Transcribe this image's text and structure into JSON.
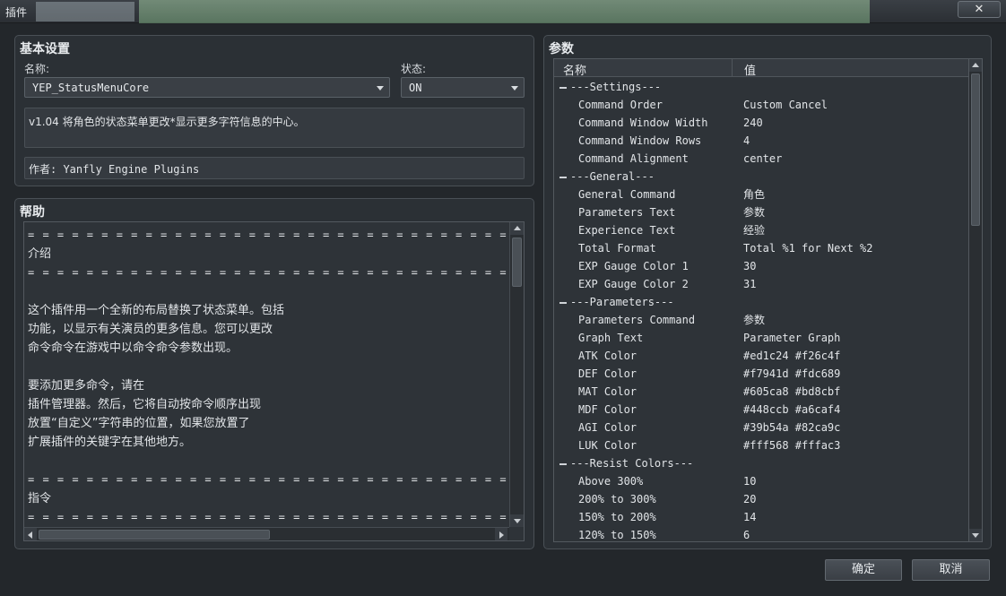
{
  "window": {
    "title": "插件",
    "close_glyph": "✕"
  },
  "basic": {
    "title": "基本设置",
    "name_label": "名称:",
    "name_value": "YEP_StatusMenuCore",
    "status_label": "状态:",
    "status_value": "ON",
    "description": "v1.04 将角色的状态菜单更改*显示更多字符信息的中心。",
    "author": "作者: Yanfly Engine Plugins"
  },
  "help": {
    "title": "帮助",
    "lines": [
      "= = = = = = = = = = = = = = = = = = = = = = = = = = = = = = = = = = = = = = = = = = = = = =",
      "介绍",
      "= = = = = = = = = = = = = = = = = = = = = = = = = = = = = = = = = = = = = = = = = = = = = =",
      "",
      "这个插件用一个全新的布局替换了状态菜单。包括",
      "功能，以显示有关演员的更多信息。您可以更改",
      "命令命令在游戏中以命令命令参数出现。",
      "",
      "要添加更多命令，请在",
      "插件管理器。然后，它将自动按命令顺序出现",
      "放置“自定义”字符串的位置，如果您放置了",
      "扩展插件的关键字在其他地方。",
      "",
      "= = = = = = = = = = = = = = = = = = = = = = = = = = = = = = = = = = = = = = = = = = = = = =",
      "指令",
      "= = = = = = = = = = = = = = = = = = = = = = = = = = = = = = = = = = = = = = = = = = = = = ="
    ]
  },
  "params": {
    "title": "参数",
    "col_name": "名称",
    "col_value": "值",
    "rows": [
      {
        "group": true,
        "name": "---Settings---",
        "value": ""
      },
      {
        "group": false,
        "name": "Command Order",
        "value": "Custom Cancel"
      },
      {
        "group": false,
        "name": "Command Window Width",
        "value": "240"
      },
      {
        "group": false,
        "name": "Command Window Rows",
        "value": "4"
      },
      {
        "group": false,
        "name": "Command Alignment",
        "value": "center"
      },
      {
        "group": true,
        "name": "---General---",
        "value": ""
      },
      {
        "group": false,
        "name": "General Command",
        "value": "角色"
      },
      {
        "group": false,
        "name": "Parameters Text",
        "value": "参数"
      },
      {
        "group": false,
        "name": "Experience Text",
        "value": "经验"
      },
      {
        "group": false,
        "name": "Total Format",
        "value": "Total %1 for Next %2"
      },
      {
        "group": false,
        "name": "EXP Gauge Color 1",
        "value": "30"
      },
      {
        "group": false,
        "name": "EXP Gauge Color 2",
        "value": "31"
      },
      {
        "group": true,
        "name": "---Parameters---",
        "value": ""
      },
      {
        "group": false,
        "name": "Parameters Command",
        "value": "参数"
      },
      {
        "group": false,
        "name": "Graph Text",
        "value": "Parameter Graph"
      },
      {
        "group": false,
        "name": "ATK Color",
        "value": "#ed1c24 #f26c4f"
      },
      {
        "group": false,
        "name": "DEF Color",
        "value": "#f7941d #fdc689"
      },
      {
        "group": false,
        "name": "MAT Color",
        "value": "#605ca8 #bd8cbf"
      },
      {
        "group": false,
        "name": "MDF Color",
        "value": "#448ccb #a6caf4"
      },
      {
        "group": false,
        "name": "AGI Color",
        "value": "#39b54a #82ca9c"
      },
      {
        "group": false,
        "name": "LUK Color",
        "value": "#fff568 #fffac3"
      },
      {
        "group": true,
        "name": "---Resist Colors---",
        "value": ""
      },
      {
        "group": false,
        "name": "Above 300%",
        "value": "10"
      },
      {
        "group": false,
        "name": "200% to 300%",
        "value": "20"
      },
      {
        "group": false,
        "name": "150% to 200%",
        "value": "14"
      },
      {
        "group": false,
        "name": "120% to 150%",
        "value": "6"
      }
    ]
  },
  "buttons": {
    "ok": "确定",
    "cancel": "取消"
  }
}
